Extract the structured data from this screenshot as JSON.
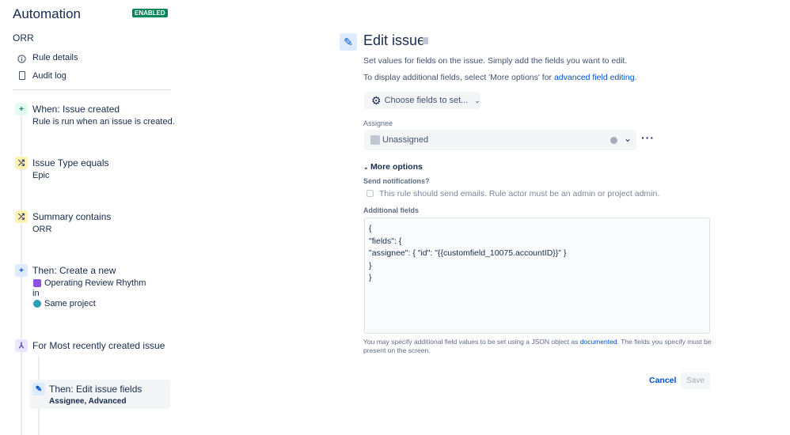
{
  "sidebar": {
    "title": "Automation",
    "badge": "ENABLED",
    "rule_name": "ORR",
    "nav": [
      {
        "label": "Rule details",
        "icon": "info-icon"
      },
      {
        "label": "Audit log",
        "icon": "document-icon"
      }
    ],
    "steps": [
      {
        "title": "When: Issue created",
        "sub": "Rule is run when an issue is created.",
        "icon": "plus-icon"
      },
      {
        "title": "Issue Type equals",
        "sub": "Epic",
        "icon": "shuffle-icon"
      },
      {
        "title": "Summary contains",
        "sub": "ORR",
        "icon": "shuffle-icon"
      },
      {
        "title": "Then: Create a new",
        "issue_type": "Operating Review Rhythm",
        "in": "in",
        "project": "Same project",
        "icon": "plus-icon"
      },
      {
        "title": "For Most recently created issue",
        "icon": "branch-icon"
      },
      {
        "title": "Then: Edit issue fields",
        "sub_a": "Assignee",
        "sep": ", ",
        "sub_b": "Advanced",
        "icon": "pencil-icon"
      }
    ]
  },
  "main": {
    "title": "Edit issue",
    "desc1": "Set values for fields on the issue. Simply add the fields you want to edit.",
    "desc2": "To display additional fields, select 'More options' for ",
    "desc2_link": "advanced field editing",
    "desc2_end": ".",
    "choose_fields": "Choose fields to set...",
    "assignee_label": "Assignee",
    "assignee_value": "Unassigned",
    "more_options": "More options",
    "notif_label": "Send notifications?",
    "notif_checkbox": "This rule should send emails. Rule actor must be an admin or project admin.",
    "notif_checked": false,
    "additional_label": "Additional fields",
    "additional_value": "{\n\"fields\": {\n\"assignee\": { \"id\": \"{{customfield_10075.accountID}}\" }\n}\n}",
    "help_pre": "You may specify additional field values to be set using a JSON object as ",
    "help_link": "documented",
    "help_post": ". The fields you specify must be present on the screen.",
    "cancel": "Cancel",
    "save": "Save"
  },
  "colors": {
    "accent": "#0052cc",
    "enabled": "#00875a"
  }
}
